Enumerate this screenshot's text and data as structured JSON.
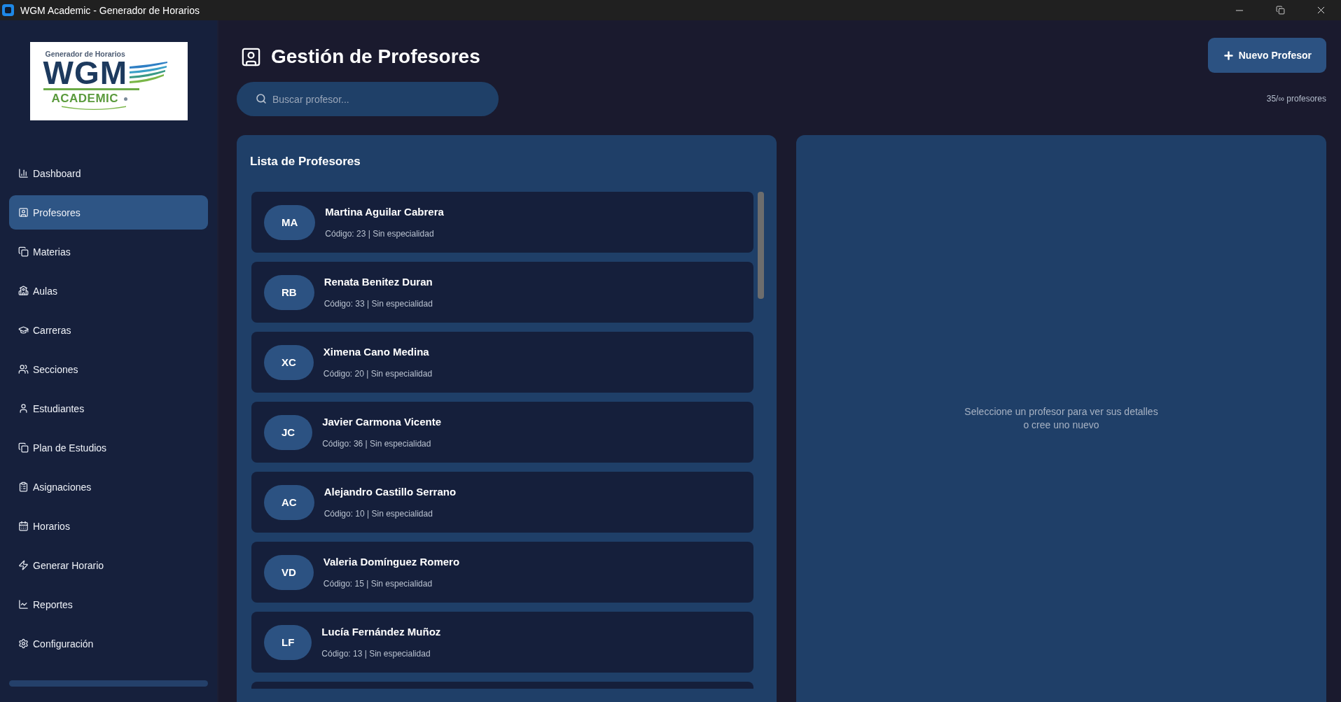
{
  "window": {
    "title": "WGM Academic - Generador de Horarios"
  },
  "logo": {
    "tagline": "Generador de Horarios",
    "wordmark": "WGM",
    "subtitle": "ACADEMIC"
  },
  "sidebar": {
    "items": [
      {
        "label": "Dashboard",
        "selected": false
      },
      {
        "label": "Profesores",
        "selected": true
      },
      {
        "label": "Materias",
        "selected": false
      },
      {
        "label": "Aulas",
        "selected": false
      },
      {
        "label": "Carreras",
        "selected": false
      },
      {
        "label": "Secciones",
        "selected": false
      },
      {
        "label": "Estudiantes",
        "selected": false
      },
      {
        "label": "Plan de Estudios",
        "selected": false
      },
      {
        "label": "Asignaciones",
        "selected": false
      },
      {
        "label": "Horarios",
        "selected": false
      },
      {
        "label": "Generar Horario",
        "selected": false
      },
      {
        "label": "Reportes",
        "selected": false
      },
      {
        "label": "Configuración",
        "selected": false
      }
    ]
  },
  "header": {
    "title": "Gestión de Profesores",
    "search": {
      "placeholder": "Buscar profesor..."
    },
    "new_button": "Nuevo Profesor",
    "count": "35/∞ profesores"
  },
  "list": {
    "title": "Lista de Profesores",
    "professors": [
      {
        "initials": "MA",
        "name": "Martina Aguilar Cabrera",
        "detail": "Código: 23 | Sin especialidad"
      },
      {
        "initials": "RB",
        "name": "Renata Benitez Duran",
        "detail": "Código: 33 | Sin especialidad"
      },
      {
        "initials": "XC",
        "name": "Ximena Cano Medina",
        "detail": "Código: 20 | Sin especialidad"
      },
      {
        "initials": "JC",
        "name": "Javier Carmona Vicente",
        "detail": "Código: 36 | Sin especialidad"
      },
      {
        "initials": "AC",
        "name": "Alejandro Castillo Serrano",
        "detail": "Código: 10 | Sin especialidad"
      },
      {
        "initials": "VD",
        "name": "Valeria Domínguez Romero",
        "detail": "Código: 15 | Sin especialidad"
      },
      {
        "initials": "LF",
        "name": "Lucía Fernández Muñoz",
        "detail": "Código: 13 | Sin especialidad"
      }
    ]
  },
  "details": {
    "empty_message": [
      "Seleccione un profesor para ver sus detalles",
      "o cree uno nuevo"
    ]
  }
}
